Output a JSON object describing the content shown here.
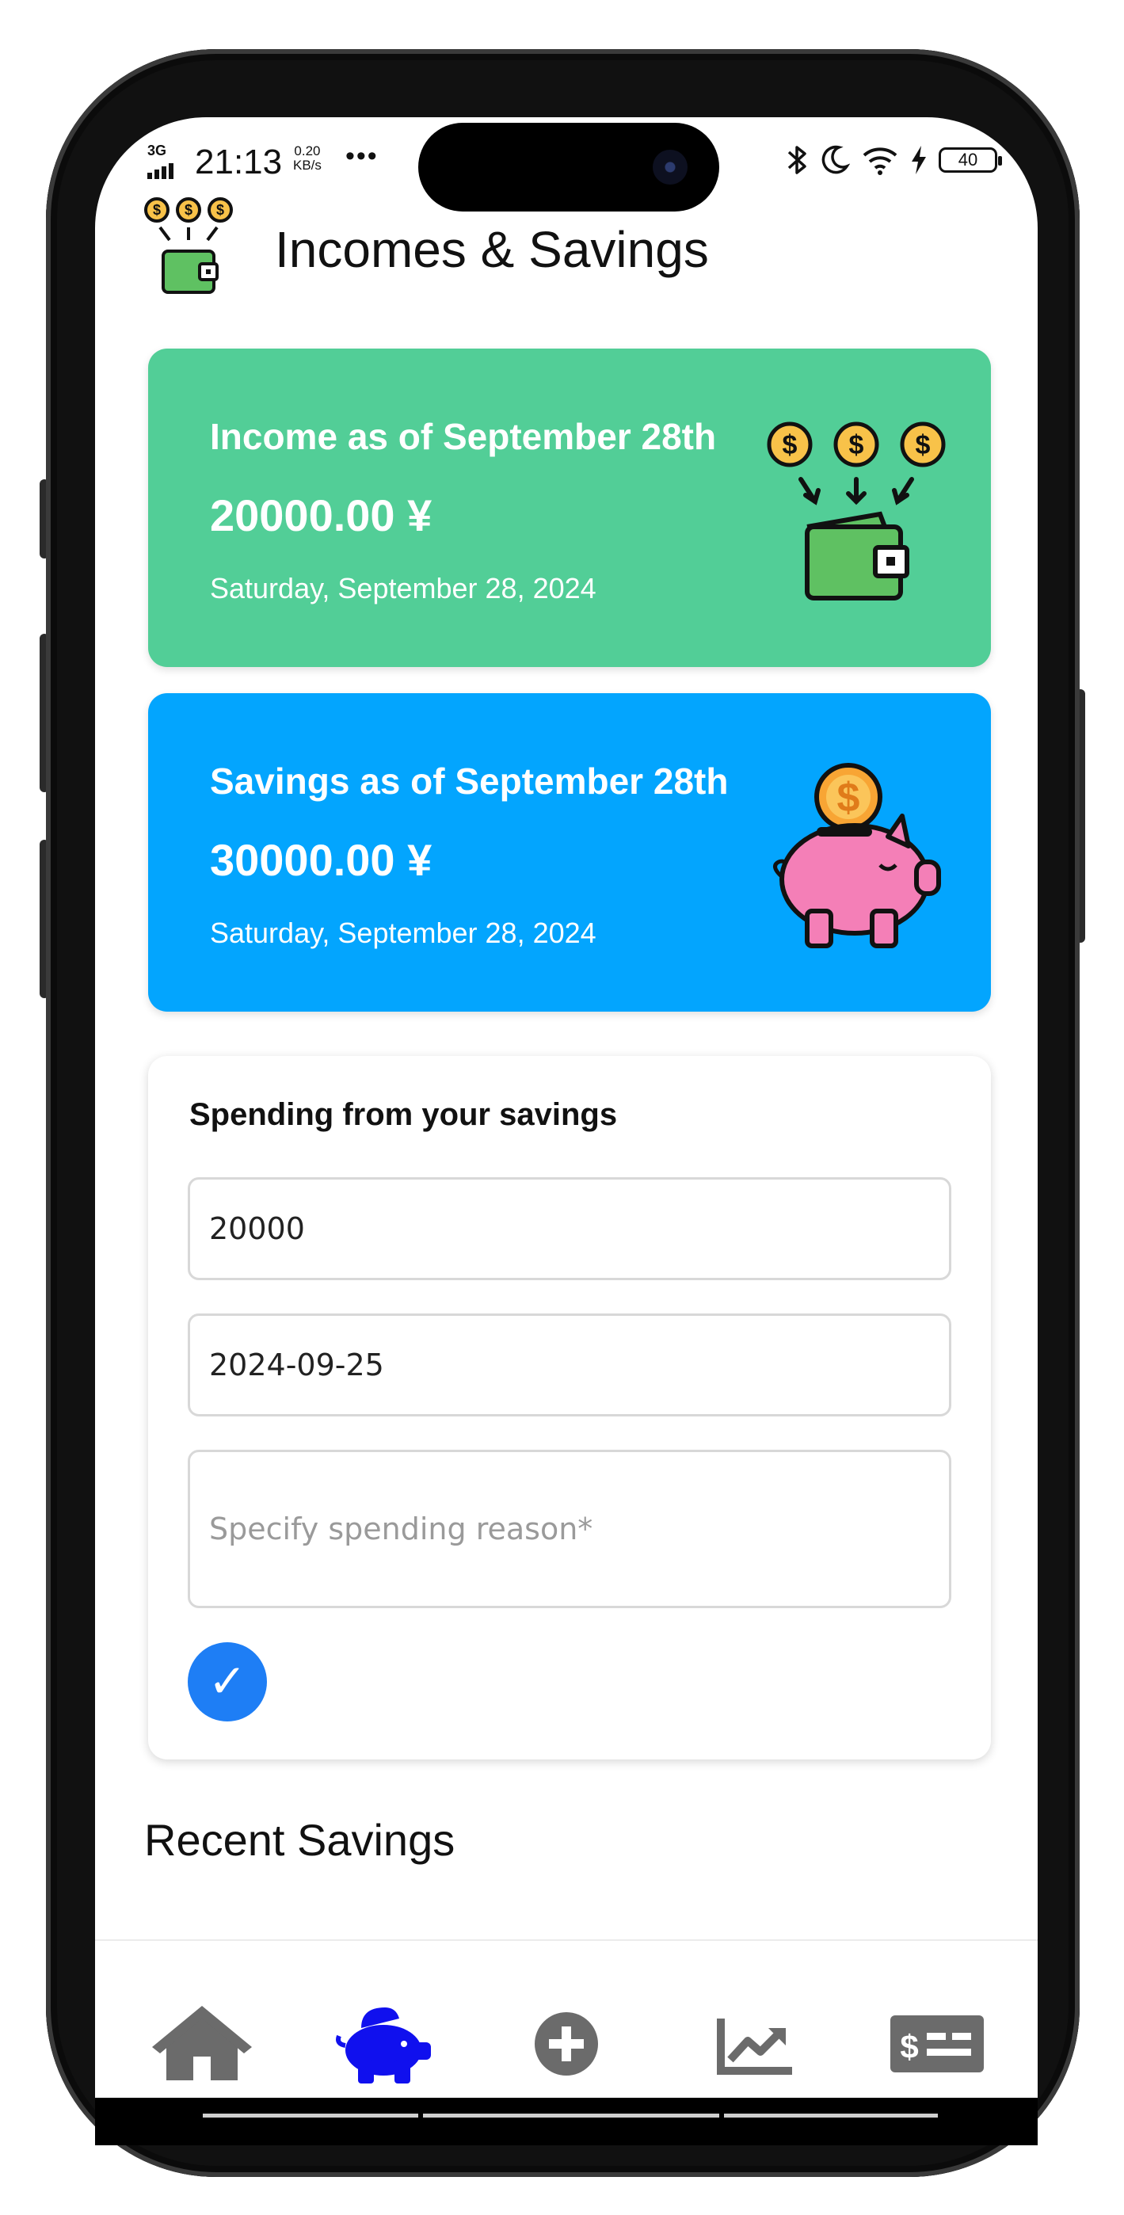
{
  "status_bar": {
    "network": "3G",
    "time": "21:13",
    "speed_value": "0.20",
    "speed_unit": "KB/s",
    "more": "•••",
    "battery": "40"
  },
  "header": {
    "title": "Incomes & Savings",
    "logo_icon": "wallet-coins-icon"
  },
  "income_card": {
    "title": "Income as of September 28th",
    "amount": "20000.00 ¥",
    "date": "Saturday, September 28, 2024",
    "color": "#52ce97",
    "icon": "wallet-coins-icon"
  },
  "savings_card": {
    "title": "Savings as of September 28th",
    "amount": "30000.00 ¥",
    "date": "Saturday, September 28, 2024",
    "color": "#03a5fe",
    "icon": "piggy-bank-icon"
  },
  "spending_form": {
    "title": "Spending from your savings",
    "amount_value": "20000",
    "date_value": "2024-09-25",
    "reason_placeholder": "Specify spending reason*",
    "submit_icon": "✓",
    "submit_color": "#1e7ef5"
  },
  "recent": {
    "title": "Recent Savings"
  },
  "nav": {
    "active_color": "#1010ee",
    "inactive_color": "#6b6b6b",
    "items": [
      {
        "icon": "home-icon",
        "active": false
      },
      {
        "icon": "piggy-bank-icon",
        "active": true
      },
      {
        "icon": "plus-circle-icon",
        "active": false
      },
      {
        "icon": "chart-line-icon",
        "active": false
      },
      {
        "icon": "money-bill-icon",
        "active": false
      }
    ]
  }
}
